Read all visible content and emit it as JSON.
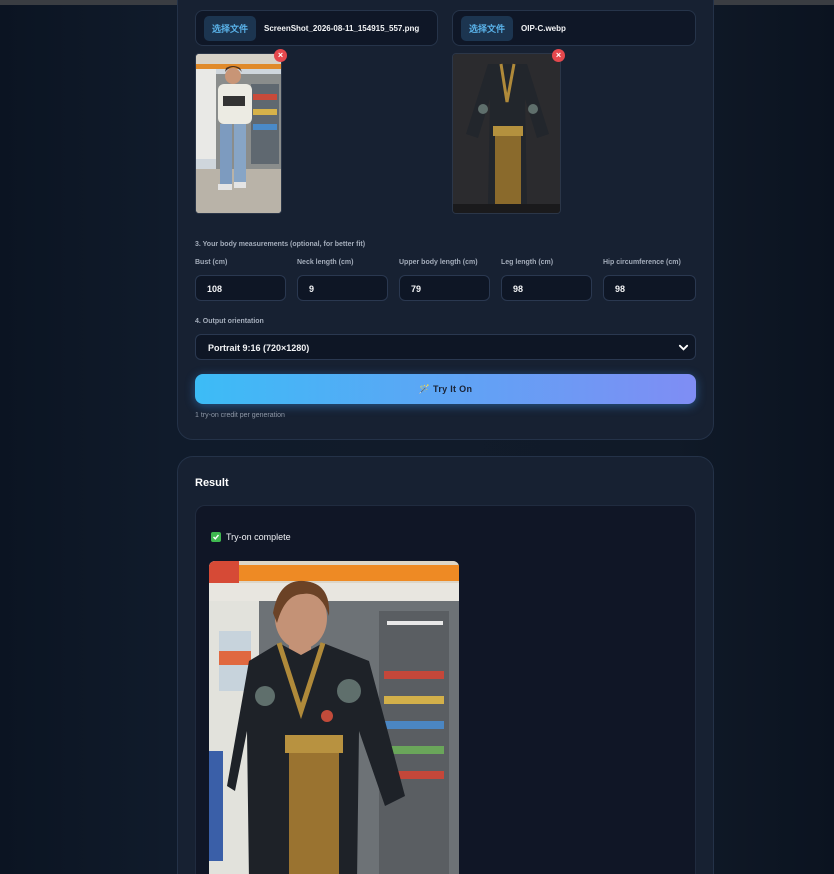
{
  "upload": {
    "person": {
      "button": "选择文件",
      "file_name": "ScreenShot_2026-08-11_154915_557.png",
      "delete": "×"
    },
    "garment": {
      "button": "选择文件",
      "file_name": "OIP-C.webp",
      "delete": "×"
    }
  },
  "measurements": {
    "heading": "3. Your body measurements (optional, for better fit)",
    "fields": [
      {
        "label": "Bust (cm)",
        "value": "108"
      },
      {
        "label": "Neck length (cm)",
        "value": "9"
      },
      {
        "label": "Upper body length (cm)",
        "value": "79"
      },
      {
        "label": "Leg length (cm)",
        "value": "98"
      },
      {
        "label": "Hip circumference (cm)",
        "value": "98"
      }
    ]
  },
  "orientation": {
    "heading": "4. Output orientation",
    "selected": "Portrait 9:16 (720×1280)"
  },
  "action": {
    "button": "🪄 Try It On",
    "credit_note": "1 try-on credit per generation"
  },
  "result": {
    "title": "Result",
    "status": "Try-on complete"
  },
  "colors": {
    "accent_start": "#3cbcf6",
    "accent_end": "#7f8df4",
    "delete": "#e5484d",
    "success": "#3fb950"
  }
}
